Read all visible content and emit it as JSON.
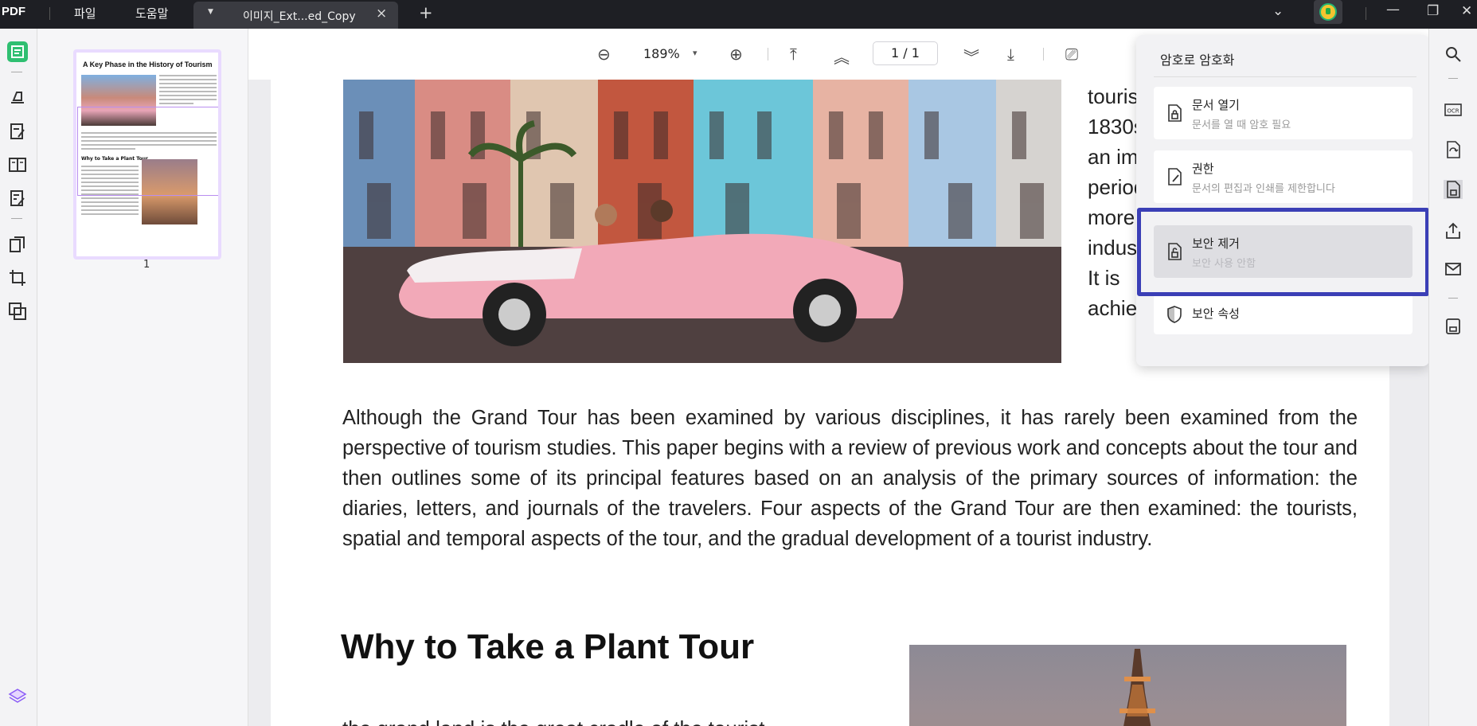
{
  "app": {
    "logo": "PDF"
  },
  "menu": {
    "file": "파일",
    "help": "도움말"
  },
  "tab": {
    "title": "이미지_Ext...ed_Copy",
    "close": "×",
    "add": "+"
  },
  "window": {
    "chevron": "⌄",
    "minimize": "—",
    "restore": "❐",
    "close": "✕"
  },
  "toolbar": {
    "zoom_out": "⊖",
    "zoom": "189%",
    "zoom_caret": "▾",
    "zoom_in": "⊕",
    "first_page": "⤒",
    "prev_page": "︽",
    "page_current": "1",
    "page_sep": "/",
    "page_total": "1",
    "next_page": "︾",
    "last_page": "⤓",
    "present": "⎚"
  },
  "thumbnail": {
    "title": "A Key Phase in the History of Tourism",
    "subtitle": "Why to Take a Plant Tour",
    "page_number": "1"
  },
  "document": {
    "side_lines": [
      "tourists",
      "1830s",
      "an  imp",
      "period i",
      "more  t",
      "industry",
      "It   is",
      "achievi"
    ],
    "paragraph": "Although the Grand Tour has been examined by various disciplines, it has rarely been examined from the perspective of tourism studies. This paper begins with a review of previous work and concepts about the tour and then outlines some of its principal features based on an analysis of the primary sources of information: the diaries, letters, and journals of the travelers. Four aspects of the Grand Tour are then examined: the tourists, spatial and temporal aspects of the tour, and the gradual development of a tourist industry.",
    "heading": "Why to Take a Plant Tour",
    "bottom_line": "the  grand  land  is  the  great  cradle  of  the  tourist"
  },
  "security_menu": {
    "title": "암호로 암호화",
    "items": [
      {
        "label": "문서 열기",
        "desc": "문서를 열 때 암호 필요",
        "icon": "lock-file-icon"
      },
      {
        "label": "권한",
        "desc": "문서의 편집과 인쇄를 제한합니다",
        "icon": "edit-file-icon"
      },
      {
        "label": "보안 제거",
        "desc": "보안 사용 안함",
        "icon": "unlock-file-icon"
      },
      {
        "label": "보안 속성",
        "desc": "",
        "icon": "shield-icon"
      }
    ]
  },
  "colors": {
    "accent": "#3b3fb6",
    "brand_green": "#22b573",
    "titlebar": "#1e1f24"
  }
}
